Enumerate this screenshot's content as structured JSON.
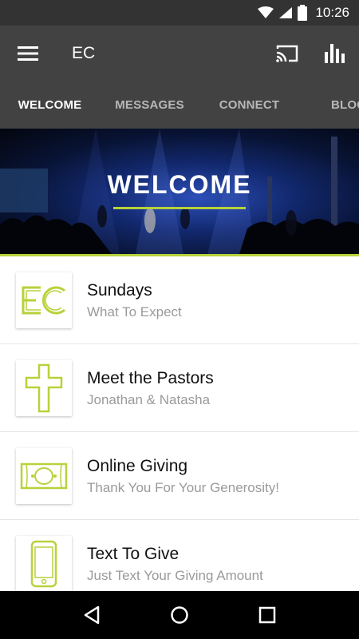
{
  "status_bar": {
    "time": "10:26",
    "icons": [
      "wifi-icon",
      "signal-icon",
      "battery-icon"
    ]
  },
  "app_bar": {
    "title": "EC",
    "actions": [
      "cast-icon",
      "bar-chart-icon"
    ]
  },
  "tabs": [
    {
      "label": "WELCOME",
      "active": true
    },
    {
      "label": "MESSAGES",
      "active": false
    },
    {
      "label": "CONNECT",
      "active": false
    },
    {
      "label": "BLOG",
      "active": false
    }
  ],
  "hero": {
    "title": "WELCOME"
  },
  "items": [
    {
      "title": "Sundays",
      "subtitle": "What To Expect",
      "icon": "ec-logo-icon"
    },
    {
      "title": "Meet the Pastors",
      "subtitle": "Jonathan & Natasha",
      "icon": "cross-icon"
    },
    {
      "title": "Online Giving",
      "subtitle": "Thank You For Your Generosity!",
      "icon": "money-icon"
    },
    {
      "title": "Text To Give",
      "subtitle": "Just Text Your Giving Amount",
      "icon": "phone-icon"
    }
  ],
  "nav_bar": {
    "buttons": [
      "back-icon",
      "home-icon",
      "recents-icon"
    ]
  },
  "colors": {
    "accent": "#b7d23a",
    "app_bar": "#424242",
    "status_bar": "#333333"
  }
}
